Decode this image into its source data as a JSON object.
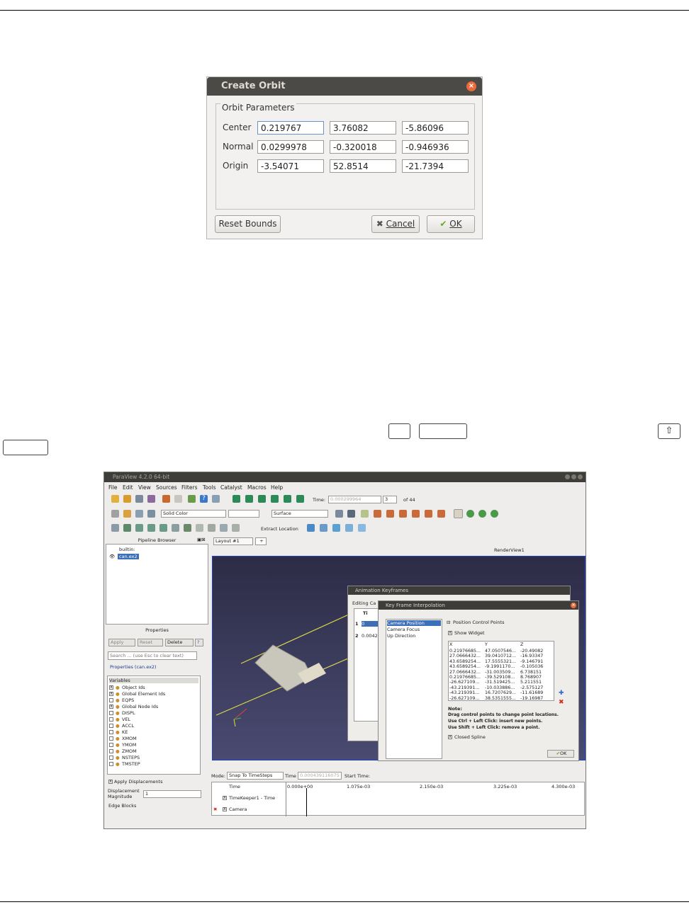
{
  "create_orbit": {
    "title": "Create Orbit",
    "group_title": "Orbit Parameters",
    "rows": [
      {
        "label": "Center",
        "values": [
          "0.219767",
          "3.76082",
          "-5.86096"
        ]
      },
      {
        "label": "Normal",
        "values": [
          "0.0299978",
          "-0.320018",
          "-0.946936"
        ]
      },
      {
        "label": "Origin",
        "values": [
          "-3.54071",
          "52.8514",
          "-21.7394"
        ]
      }
    ],
    "reset_bounds": "Reset Bounds",
    "cancel": "Cancel",
    "ok": "OK"
  },
  "keys": {
    "ctrl": "",
    "space": "",
    "shift": "⇧",
    "enter": ""
  },
  "paraview": {
    "window_title": "ParaView 4.2.0 64-bit",
    "menu": [
      "File",
      "Edit",
      "View",
      "Sources",
      "Filters",
      "Tools",
      "Catalyst",
      "Macros",
      "Help"
    ],
    "time_label": "Time:",
    "time_value": "0.000299964",
    "time_index": "3",
    "time_of": "of 44",
    "color_by": "Solid Color",
    "representation": "Surface",
    "extract_location": "Extract Location",
    "pipeline_browser": {
      "title": "Pipeline Browser",
      "items": [
        "builtin:",
        "can.ex2"
      ]
    },
    "properties": {
      "title": "Properties",
      "apply": "Apply",
      "reset": "Reset",
      "delete": "Delete",
      "help": "?",
      "search_placeholder": "Search ... (use Esc to clear text)",
      "section": "Properties (can.ex2)",
      "variables_header": "Variables",
      "variables": [
        {
          "name": "Object Ids",
          "checked": true
        },
        {
          "name": "Global Element Ids",
          "checked": true
        },
        {
          "name": "EQPS",
          "checked": false
        },
        {
          "name": "Global Node Ids",
          "checked": true
        },
        {
          "name": "DISPL",
          "checked": false
        },
        {
          "name": "VEL",
          "checked": false
        },
        {
          "name": "ACCL",
          "checked": false
        },
        {
          "name": "KE",
          "checked": false
        },
        {
          "name": "XMOM",
          "checked": false
        },
        {
          "name": "YMOM",
          "checked": false
        },
        {
          "name": "ZMOM",
          "checked": false
        },
        {
          "name": "NSTEPS",
          "checked": false
        },
        {
          "name": "TMSTEP",
          "checked": false
        }
      ],
      "apply_displacements": "Apply Displacements",
      "displacement_magnitude_label": "Displacement Magnitude",
      "displacement_magnitude": "1",
      "edge_blocks": "Edge Blocks"
    },
    "layout_tab": "Layout #1",
    "layout_add": "+",
    "render_view": "RenderView1",
    "animation_keyframes": {
      "title": "Animation Keyframes",
      "editing": "Editing Ca",
      "col": "Ti",
      "rows": [
        [
          "1",
          "0"
        ],
        [
          "2",
          "0.0042"
        ]
      ]
    },
    "key_frame_interpolation": {
      "title": "Key Frame Interpolation",
      "list": [
        "Camera Position",
        "Camera Focus",
        "Up Direction"
      ],
      "group": "Position Control Points",
      "show_widget": "Show Widget",
      "columns": [
        "X",
        "Y",
        "Z"
      ],
      "rows": [
        [
          "0.21976685...",
          "47.0507546...",
          "-20.49082"
        ],
        [
          "27.0666432...",
          "39.0410712...",
          "-16.93347"
        ],
        [
          "43.6589254...",
          "17.5555321...",
          "-9.146791"
        ],
        [
          "43.6589254...",
          "-9.1991170...",
          "-0.105036"
        ],
        [
          "27.0666432...",
          "-31.003509...",
          "6.738151"
        ],
        [
          "0.21976685...",
          "-39.529108...",
          "8.768907"
        ],
        [
          "-26.627109...",
          "-31.519425...",
          "5.211551"
        ],
        [
          "-43.219391...",
          "-10.033886...",
          "-2.575127"
        ],
        [
          "-43.219391...",
          "16.7207629...",
          "-11.61689"
        ],
        [
          "-26.627109...",
          "38.5351555...",
          "-19.16987"
        ]
      ],
      "note_title": "Note:",
      "notes": [
        "Drag control points to change point locations.",
        "Use Ctrl + Left Click: insert new points.",
        "Use Shift + Left Click: remove a point."
      ],
      "closed_spline": "Closed Spline",
      "ok": "OK"
    },
    "timeline": {
      "mode_label": "Mode:",
      "mode": "Snap To TimeSteps",
      "time_label": "Time",
      "time_value": "0.000439116075",
      "start_time": "Start Time:",
      "ticks": [
        "0.000e+00",
        "1.075e-03",
        "2.150e-03",
        "3.225e-03",
        "4.300e-03"
      ],
      "tracks": [
        "Time",
        "TimeKeeper1 - Time",
        "Camera"
      ]
    }
  }
}
